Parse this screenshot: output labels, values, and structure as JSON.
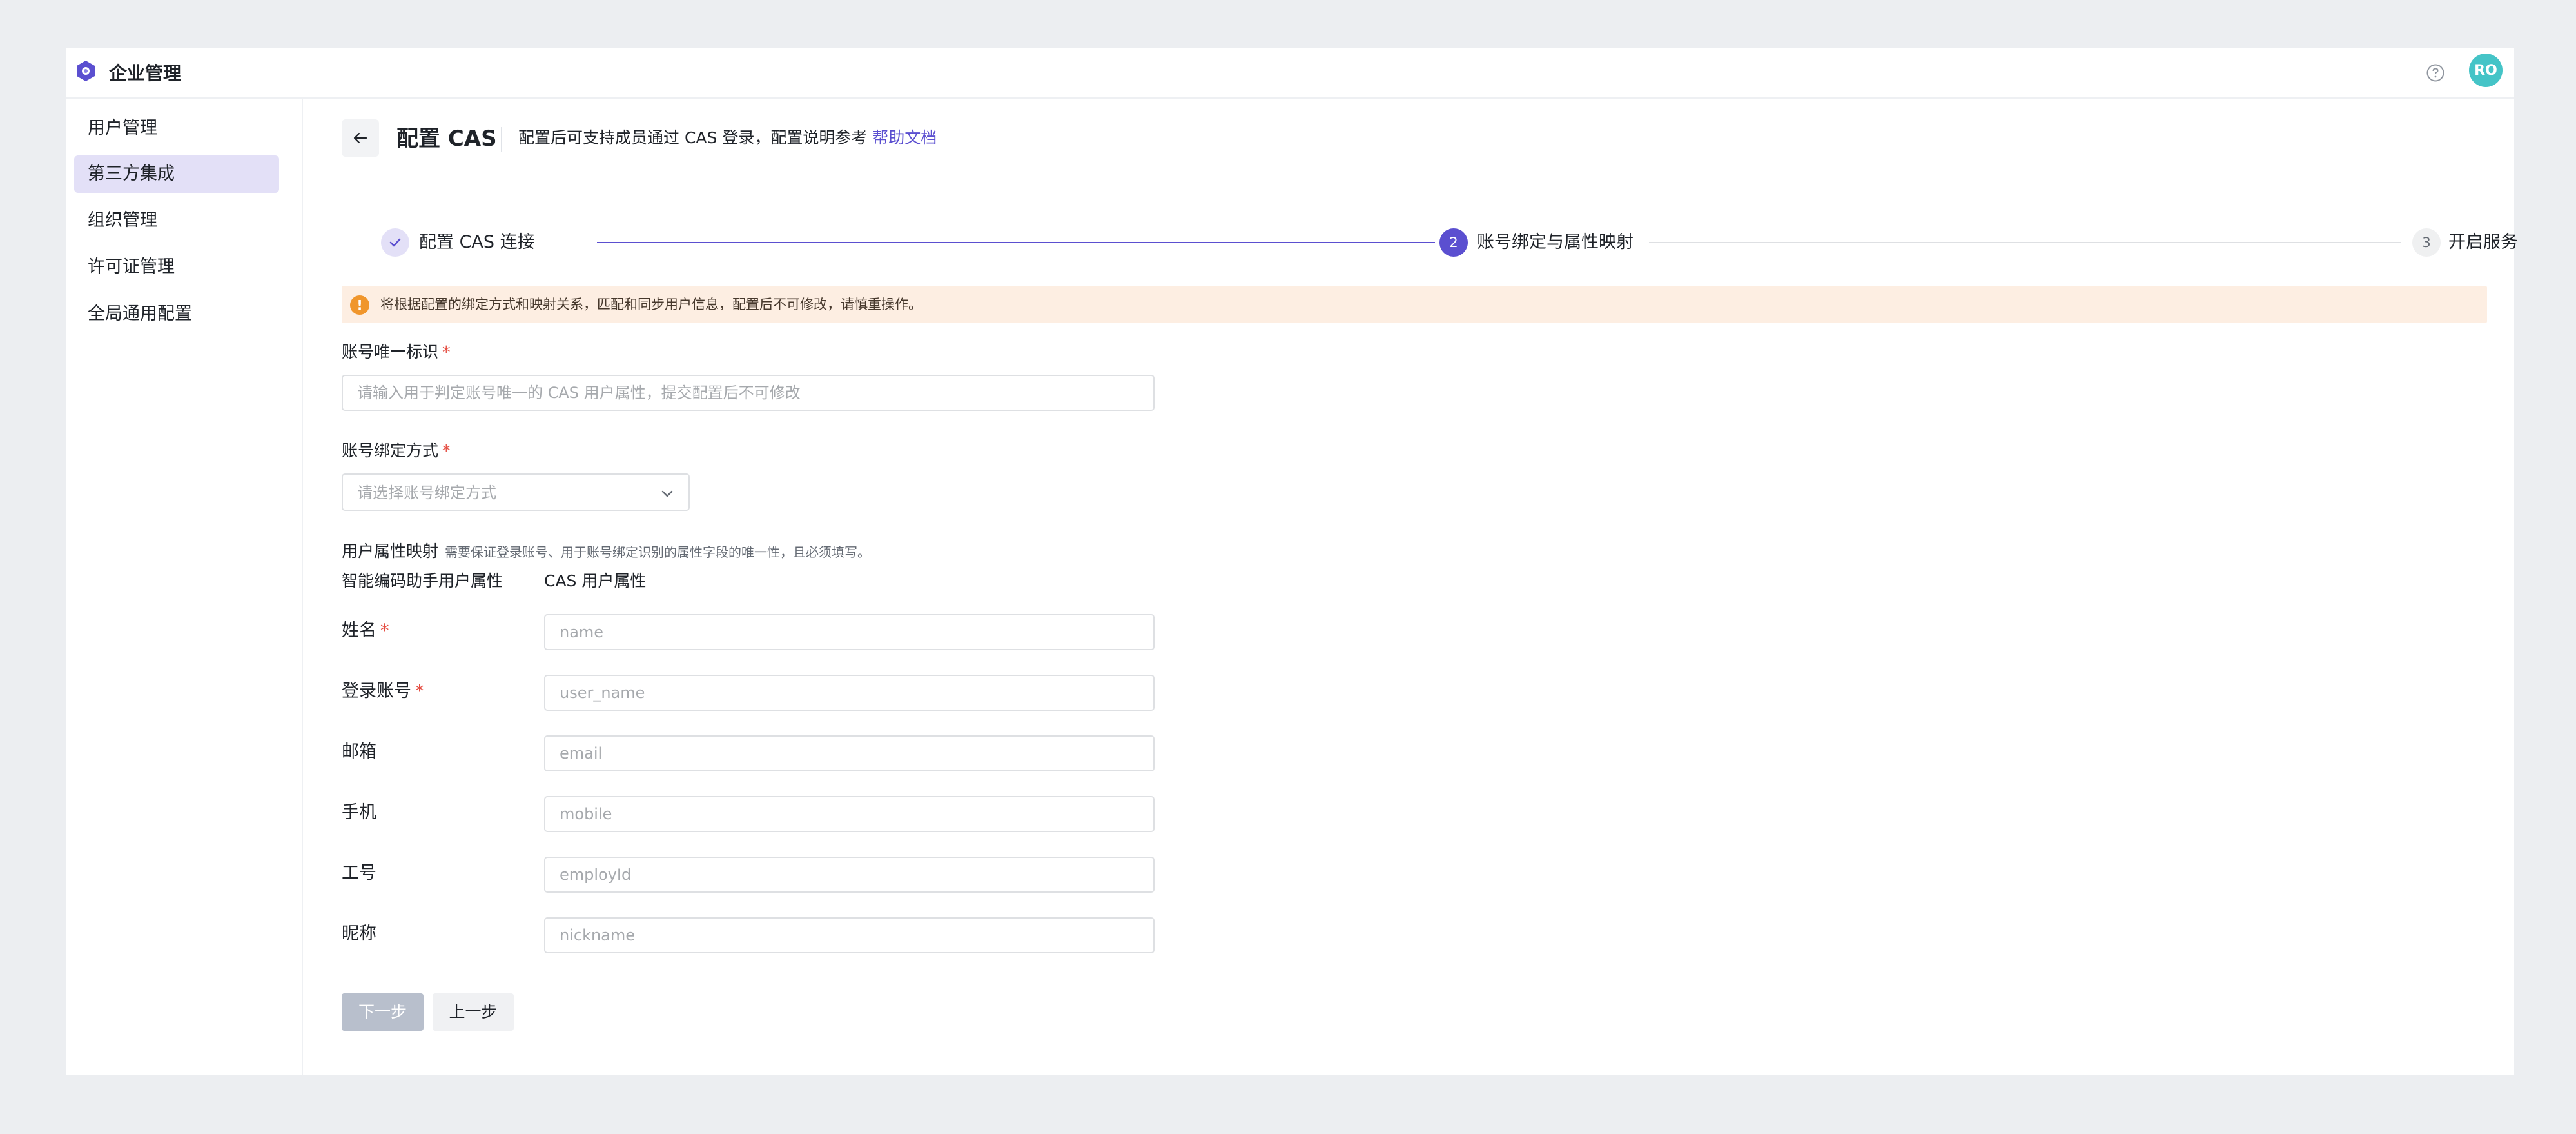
{
  "app": {
    "title": "企业管理",
    "avatar_text": "RO"
  },
  "sidebar": {
    "items": [
      {
        "label": "用户管理"
      },
      {
        "label": "第三方集成"
      },
      {
        "label": "组织管理"
      },
      {
        "label": "许可证管理"
      },
      {
        "label": "全局通用配置"
      }
    ],
    "active_index": 1
  },
  "header": {
    "title": "配置 CAS",
    "description": "配置后可支持成员通过 CAS 登录，配置说明参考",
    "help_link": "帮助文档"
  },
  "steps": [
    {
      "number": "1",
      "label": "配置 CAS 连接",
      "state": "done"
    },
    {
      "number": "2",
      "label": "账号绑定与属性映射",
      "state": "current"
    },
    {
      "number": "3",
      "label": "开启服务",
      "state": "pending"
    }
  ],
  "alert": {
    "icon": "!",
    "text": "将根据配置的绑定方式和映射关系，匹配和同步用户信息，配置后不可修改，请慎重操作。"
  },
  "form": {
    "unique_id": {
      "label": "账号唯一标识",
      "required_mark": "*",
      "placeholder": "请输入用于判定账号唯一的 CAS 用户属性，提交配置后不可修改"
    },
    "binding_method": {
      "label": "账号绑定方式",
      "required_mark": "*",
      "placeholder": "请选择账号绑定方式"
    },
    "attribute_mapping": {
      "label": "用户属性映射",
      "hint": "需要保证登录账号、用于账号绑定识别的属性字段的唯一性，且必须填写。",
      "col_left": "智能编码助手用户属性",
      "col_right": "CAS 用户属性",
      "rows": [
        {
          "label": "姓名",
          "required": "*",
          "placeholder": "name"
        },
        {
          "label": "登录账号",
          "required": "*",
          "placeholder": "user_name"
        },
        {
          "label": "邮箱",
          "required": "",
          "placeholder": "email"
        },
        {
          "label": "手机",
          "required": "",
          "placeholder": "mobile"
        },
        {
          "label": "工号",
          "required": "",
          "placeholder": "employId"
        },
        {
          "label": "昵称",
          "required": "",
          "placeholder": "nickname"
        }
      ]
    }
  },
  "buttons": {
    "next": "下一步",
    "prev": "上一步"
  },
  "colors": {
    "accent": "#5b4fd0",
    "sidebar_active_bg": "#e3e0f7",
    "alert_bg": "#fdeee2",
    "alert_icon": "#f0962c",
    "avatar_bg": "#45c4c7",
    "required": "#e54d42"
  },
  "icons": {
    "logo": "hexagon-logo-icon",
    "help": "question-circle-icon",
    "back": "arrow-left-icon",
    "step_done": "check-icon",
    "select": "chevron-down-icon"
  }
}
